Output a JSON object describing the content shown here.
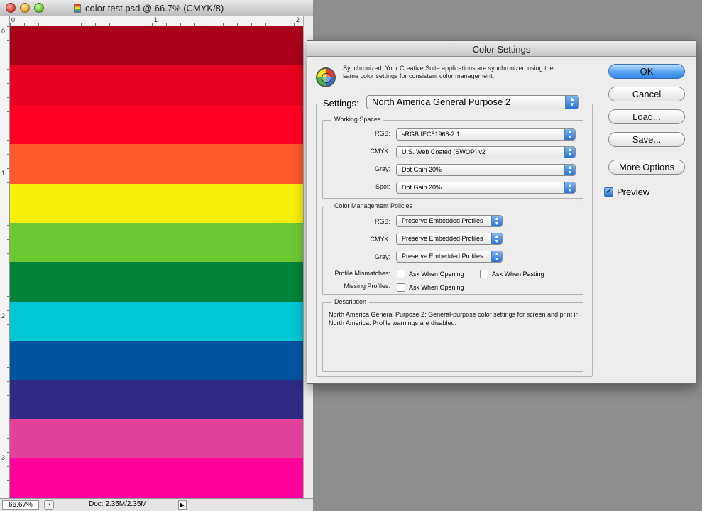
{
  "document": {
    "title": "color test.psd @ 66.7% (CMYK/8)",
    "ruler_top_ticks": [
      "0",
      "1",
      "2"
    ],
    "ruler_left_ticks": [
      "0",
      "1",
      "2",
      "3"
    ],
    "stripes": [
      "#a9001b",
      "#e8001f",
      "#ff0022",
      "#ff5a29",
      "#f9ee08",
      "#6cc932",
      "#00833a",
      "#00c7d3",
      "#00549e",
      "#2f2a84",
      "#e1419b",
      "#ff009d"
    ],
    "status": {
      "zoom": "66.67%",
      "doc_size": "Doc: 2.35M/2.35M"
    }
  },
  "dialog": {
    "title": "Color Settings",
    "sync_text": "Synchronized: Your Creative Suite applications are synchronized using the same color settings for consistent color management.",
    "settings_label": "Settings:",
    "settings_value": "North America General Purpose 2",
    "working_spaces": {
      "legend": "Working Spaces",
      "rows": [
        {
          "label": "RGB:",
          "value": "sRGB IEC61966-2.1"
        },
        {
          "label": "CMYK:",
          "value": "U.S. Web Coated (SWOP) v2"
        },
        {
          "label": "Gray:",
          "value": "Dot Gain 20%"
        },
        {
          "label": "Spot:",
          "value": "Dot Gain 20%"
        }
      ]
    },
    "policies": {
      "legend": "Color Management Policies",
      "rows": [
        {
          "label": "RGB:",
          "value": "Preserve Embedded Profiles"
        },
        {
          "label": "CMYK:",
          "value": "Preserve Embedded Profiles"
        },
        {
          "label": "Gray:",
          "value": "Preserve Embedded Profiles"
        }
      ],
      "profile_mismatches_label": "Profile Mismatches:",
      "ask_when_opening": "Ask When Opening",
      "ask_when_pasting": "Ask When Pasting",
      "missing_profiles_label": "Missing Profiles:",
      "missing_ask_when_opening": "Ask When Opening"
    },
    "description": {
      "legend": "Description",
      "text": "North America General Purpose 2:  General-purpose color settings for screen and print in North America. Profile warnings are disabled."
    },
    "buttons": {
      "ok": "OK",
      "cancel": "Cancel",
      "load": "Load...",
      "save": "Save...",
      "more_options": "More Options"
    },
    "preview_label": "Preview",
    "preview_checked": true
  }
}
